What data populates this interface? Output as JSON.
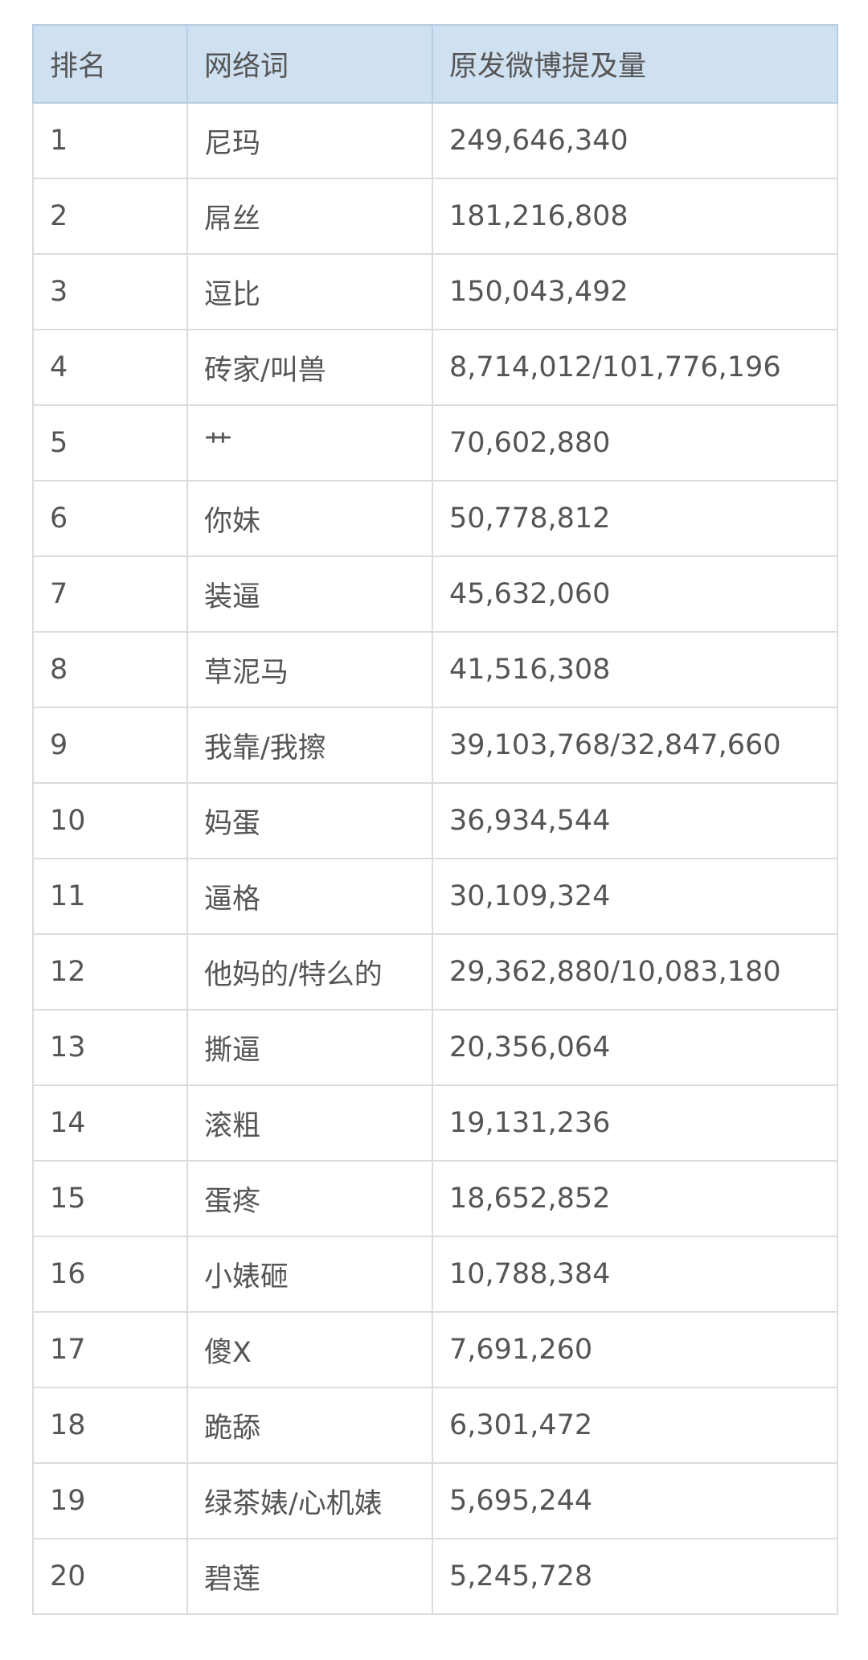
{
  "table": {
    "headers": [
      "排名",
      "网络词",
      "原发微博提及量"
    ],
    "rows": [
      {
        "rank": "1",
        "word": "尼玛",
        "count": "249,646,340"
      },
      {
        "rank": "2",
        "word": "屌丝",
        "count": "181,216,808"
      },
      {
        "rank": "3",
        "word": "逗比",
        "count": "150,043,492"
      },
      {
        "rank": "4",
        "word": "砖家/叫兽",
        "count": "8,714,012/101,776,196"
      },
      {
        "rank": "5",
        "word": "艹",
        "count": "70,602,880"
      },
      {
        "rank": "6",
        "word": "你妹",
        "count": "50,778,812"
      },
      {
        "rank": "7",
        "word": "装逼",
        "count": "45,632,060"
      },
      {
        "rank": "8",
        "word": "草泥马",
        "count": "41,516,308"
      },
      {
        "rank": "9",
        "word": "我靠/我擦",
        "count": "39,103,768/32,847,660"
      },
      {
        "rank": "10",
        "word": "妈蛋",
        "count": "36,934,544"
      },
      {
        "rank": "11",
        "word": "逼格",
        "count": "30,109,324"
      },
      {
        "rank": "12",
        "word": "他妈的/特么的",
        "count": "29,362,880/10,083,180"
      },
      {
        "rank": "13",
        "word": "撕逼",
        "count": "20,356,064"
      },
      {
        "rank": "14",
        "word": "滚粗",
        "count": "19,131,236"
      },
      {
        "rank": "15",
        "word": "蛋疼",
        "count": "18,652,852"
      },
      {
        "rank": "16",
        "word": "小婊砸",
        "count": "10,788,384"
      },
      {
        "rank": "17",
        "word": "傻X",
        "count": "7,691,260"
      },
      {
        "rank": "18",
        "word": "跪舔",
        "count": "6,301,472"
      },
      {
        "rank": "19",
        "word": "绿茶婊/心机婊",
        "count": "5,695,244"
      },
      {
        "rank": "20",
        "word": "碧莲",
        "count": "5,245,728"
      }
    ]
  }
}
